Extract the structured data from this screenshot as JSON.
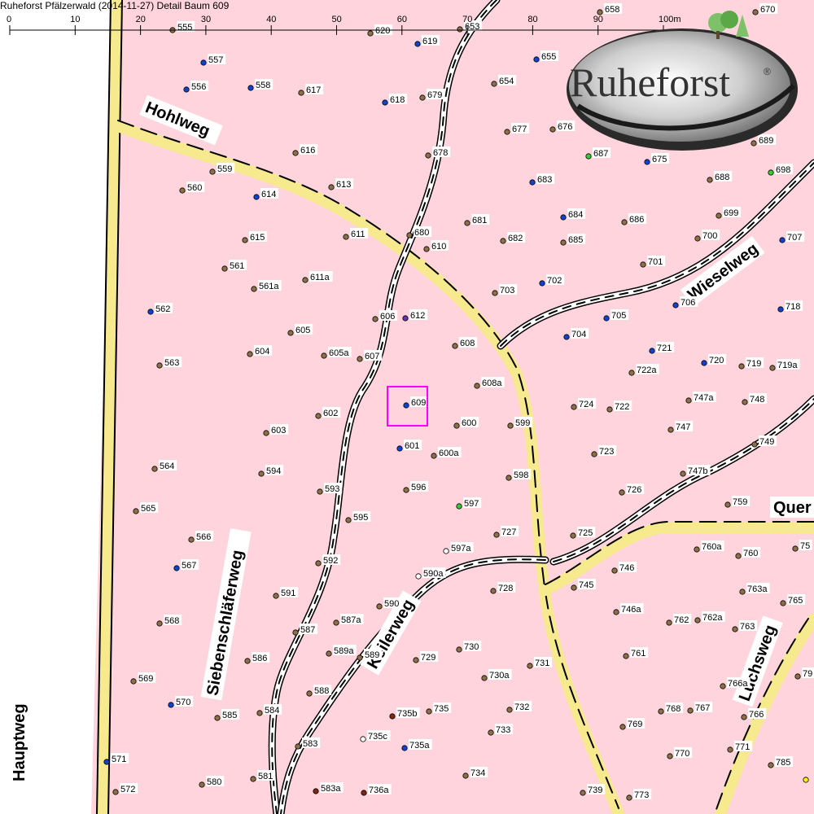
{
  "window_title": "Ruheforst Pfälzerwald (2014-11-27) Detail  Baum 609",
  "scale": {
    "ticks": [
      "0",
      "10",
      "20",
      "30",
      "40",
      "50",
      "60",
      "70",
      "80",
      "90",
      "100m"
    ]
  },
  "logo": {
    "text": "Ruheforst",
    "mark": "®"
  },
  "roads": {
    "hauptweg": "Hauptweg",
    "hohlweg": "Hohlweg",
    "wieselweg": "Wieselweg",
    "siebenschlaeferweg": "Siebenschläferweg",
    "keilerweg": "Keilerweg",
    "luchsweg": "Luchsweg",
    "querweg": "Quer"
  },
  "highlight": {
    "tree": "609"
  },
  "colors": {
    "background": "#ffd4dc",
    "main_road": "#f7e98e",
    "path_dash": "#000000",
    "tree_brown": "#8b7149",
    "tree_blue": "#1144cc",
    "tree_green": "#33cc33",
    "tree_purple": "#6633aa",
    "tree_white": "#ffffff",
    "tree_red": "#7a2a10",
    "tree_yellow": "#ffee00",
    "highlight": "#ff00ff"
  },
  "trees": [
    {
      "id": "555",
      "c": "brown"
    },
    {
      "id": "557",
      "c": "blue"
    },
    {
      "id": "556",
      "c": "blue"
    },
    {
      "id": "558",
      "c": "blue"
    },
    {
      "id": "617",
      "c": "brown"
    },
    {
      "id": "620",
      "c": "brown"
    },
    {
      "id": "619",
      "c": "blue"
    },
    {
      "id": "653",
      "c": "brown"
    },
    {
      "id": "658",
      "c": "brown"
    },
    {
      "id": "670",
      "c": "brown"
    },
    {
      "id": "655",
      "c": "blue"
    },
    {
      "id": "654",
      "c": "brown"
    },
    {
      "id": "618",
      "c": "blue"
    },
    {
      "id": "679",
      "c": "brown"
    },
    {
      "id": "677",
      "c": "brown"
    },
    {
      "id": "676",
      "c": "brown"
    },
    {
      "id": "687",
      "c": "green"
    },
    {
      "id": "675",
      "c": "blue"
    },
    {
      "id": "689",
      "c": "brown"
    },
    {
      "id": "678",
      "c": "brown"
    },
    {
      "id": "616",
      "c": "brown"
    },
    {
      "id": "559",
      "c": "brown"
    },
    {
      "id": "560",
      "c": "brown"
    },
    {
      "id": "613",
      "c": "brown"
    },
    {
      "id": "614",
      "c": "blue"
    },
    {
      "id": "683",
      "c": "blue"
    },
    {
      "id": "688",
      "c": "brown"
    },
    {
      "id": "698",
      "c": "green"
    },
    {
      "id": "684",
      "c": "blue"
    },
    {
      "id": "686",
      "c": "brown"
    },
    {
      "id": "699",
      "c": "brown"
    },
    {
      "id": "681",
      "c": "brown"
    },
    {
      "id": "680",
      "c": "brown"
    },
    {
      "id": "682",
      "c": "brown"
    },
    {
      "id": "685",
      "c": "brown"
    },
    {
      "id": "700",
      "c": "brown"
    },
    {
      "id": "707",
      "c": "blue"
    },
    {
      "id": "615",
      "c": "brown"
    },
    {
      "id": "611",
      "c": "brown"
    },
    {
      "id": "610",
      "c": "brown"
    },
    {
      "id": "561",
      "c": "brown"
    },
    {
      "id": "561a",
      "c": "brown"
    },
    {
      "id": "611a",
      "c": "brown"
    },
    {
      "id": "701",
      "c": "brown"
    },
    {
      "id": "702",
      "c": "blue"
    },
    {
      "id": "703",
      "c": "brown"
    },
    {
      "id": "562",
      "c": "blue"
    },
    {
      "id": "606",
      "c": "brown"
    },
    {
      "id": "612",
      "c": "purple"
    },
    {
      "id": "705",
      "c": "blue"
    },
    {
      "id": "706",
      "c": "blue"
    },
    {
      "id": "718",
      "c": "blue"
    },
    {
      "id": "605",
      "c": "brown"
    },
    {
      "id": "704",
      "c": "blue"
    },
    {
      "id": "608",
      "c": "brown"
    },
    {
      "id": "721",
      "c": "blue"
    },
    {
      "id": "604",
      "c": "brown"
    },
    {
      "id": "605a",
      "c": "brown"
    },
    {
      "id": "607",
      "c": "brown"
    },
    {
      "id": "563",
      "c": "brown"
    },
    {
      "id": "720",
      "c": "blue"
    },
    {
      "id": "719",
      "c": "brown"
    },
    {
      "id": "719a",
      "c": "brown"
    },
    {
      "id": "722a",
      "c": "brown"
    },
    {
      "id": "608a",
      "c": "brown"
    },
    {
      "id": "747a",
      "c": "brown"
    },
    {
      "id": "748",
      "c": "brown"
    },
    {
      "id": "609",
      "c": "blue"
    },
    {
      "id": "724",
      "c": "brown"
    },
    {
      "id": "722",
      "c": "brown"
    },
    {
      "id": "602",
      "c": "brown"
    },
    {
      "id": "600",
      "c": "brown"
    },
    {
      "id": "599",
      "c": "brown"
    },
    {
      "id": "747",
      "c": "brown"
    },
    {
      "id": "603",
      "c": "brown"
    },
    {
      "id": "601",
      "c": "blue"
    },
    {
      "id": "600a",
      "c": "brown"
    },
    {
      "id": "749",
      "c": "brown"
    },
    {
      "id": "723",
      "c": "brown"
    },
    {
      "id": "564",
      "c": "brown"
    },
    {
      "id": "594",
      "c": "brown"
    },
    {
      "id": "598",
      "c": "brown"
    },
    {
      "id": "747b",
      "c": "brown"
    },
    {
      "id": "593",
      "c": "brown"
    },
    {
      "id": "596",
      "c": "brown"
    },
    {
      "id": "726",
      "c": "brown"
    },
    {
      "id": "597",
      "c": "green"
    },
    {
      "id": "759",
      "c": "brown"
    },
    {
      "id": "565",
      "c": "brown"
    },
    {
      "id": "595",
      "c": "brown"
    },
    {
      "id": "727",
      "c": "brown"
    },
    {
      "id": "566",
      "c": "brown"
    },
    {
      "id": "725",
      "c": "brown"
    },
    {
      "id": "760a",
      "c": "brown"
    },
    {
      "id": "597a",
      "c": "white"
    },
    {
      "id": "760",
      "c": "brown"
    },
    {
      "id": "75",
      "c": "brown"
    },
    {
      "id": "592",
      "c": "brown"
    },
    {
      "id": "567",
      "c": "blue"
    },
    {
      "id": "746",
      "c": "brown"
    },
    {
      "id": "590a",
      "c": "white"
    },
    {
      "id": "728",
      "c": "brown"
    },
    {
      "id": "745",
      "c": "brown"
    },
    {
      "id": "591",
      "c": "brown"
    },
    {
      "id": "763a",
      "c": "brown"
    },
    {
      "id": "765",
      "c": "brown"
    },
    {
      "id": "590",
      "c": "brown"
    },
    {
      "id": "746a",
      "c": "brown"
    },
    {
      "id": "568",
      "c": "brown"
    },
    {
      "id": "587a",
      "c": "brown"
    },
    {
      "id": "762",
      "c": "brown"
    },
    {
      "id": "762a",
      "c": "brown"
    },
    {
      "id": "763",
      "c": "brown"
    },
    {
      "id": "587",
      "c": "brown"
    },
    {
      "id": "730",
      "c": "brown"
    },
    {
      "id": "589a",
      "c": "brown"
    },
    {
      "id": "589",
      "c": "brown"
    },
    {
      "id": "729",
      "c": "brown"
    },
    {
      "id": "586",
      "c": "brown"
    },
    {
      "id": "761",
      "c": "brown"
    },
    {
      "id": "731",
      "c": "brown"
    },
    {
      "id": "730a",
      "c": "brown"
    },
    {
      "id": "569",
      "c": "brown"
    },
    {
      "id": "766a",
      "c": "brown"
    },
    {
      "id": "79",
      "c": "brown"
    },
    {
      "id": "588",
      "c": "brown"
    },
    {
      "id": "570",
      "c": "blue"
    },
    {
      "id": "584",
      "c": "brown"
    },
    {
      "id": "735b",
      "c": "red"
    },
    {
      "id": "735",
      "c": "brown"
    },
    {
      "id": "732",
      "c": "brown"
    },
    {
      "id": "768",
      "c": "brown"
    },
    {
      "id": "767",
      "c": "brown"
    },
    {
      "id": "585",
      "c": "brown"
    },
    {
      "id": "766",
      "c": "brown"
    },
    {
      "id": "733",
      "c": "brown"
    },
    {
      "id": "769",
      "c": "brown"
    },
    {
      "id": "735c",
      "c": "white"
    },
    {
      "id": "583",
      "c": "brown"
    },
    {
      "id": "735a",
      "c": "blue"
    },
    {
      "id": "770",
      "c": "brown"
    },
    {
      "id": "771",
      "c": "brown"
    },
    {
      "id": "571",
      "c": "blue"
    },
    {
      "id": "785",
      "c": "brown"
    },
    {
      "id": "581",
      "c": "brown"
    },
    {
      "id": "734",
      "c": "brown"
    },
    {
      "id": "580",
      "c": "brown"
    },
    {
      "id": "572",
      "c": "brown"
    },
    {
      "id": "583a",
      "c": "red"
    },
    {
      "id": "736a",
      "c": "red"
    },
    {
      "id": "739",
      "c": "brown"
    },
    {
      "id": "773",
      "c": "brown"
    },
    {
      "id": "yellow-edge",
      "c": "yellow",
      "hide_label": true
    }
  ]
}
